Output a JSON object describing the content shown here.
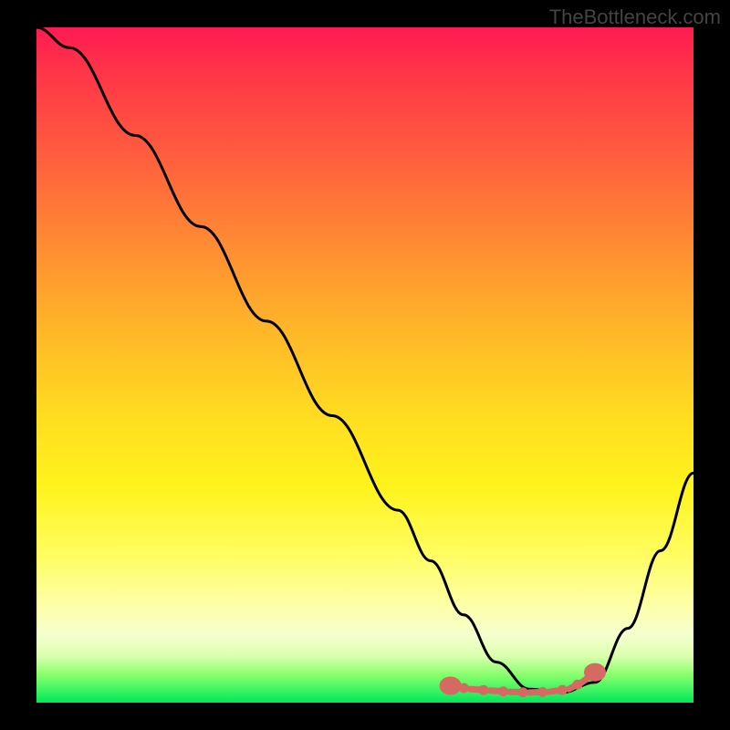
{
  "watermark": "TheBottleneck.com",
  "chart_data": {
    "type": "line",
    "title": "",
    "xlabel": "",
    "ylabel": "",
    "xlim": [
      0,
      100
    ],
    "ylim": [
      0,
      100
    ],
    "note": "Axes carry no tick labels in the source image; values below are plot-relative percentages read from pixel positions. The black curve is a V-shaped score curve; red markers indicate the flat minimum region.",
    "series": [
      {
        "name": "score-curve",
        "color": "#000000",
        "x": [
          0,
          5,
          15,
          25,
          35,
          45,
          55,
          60,
          65,
          70,
          75,
          80,
          85,
          90,
          95,
          100
        ],
        "y": [
          100,
          97,
          84,
          70.5,
          56.5,
          42.5,
          28.5,
          21,
          13,
          6,
          2,
          1.5,
          3,
          11,
          22.5,
          34
        ]
      }
    ],
    "markers": [
      {
        "name": "optimal-range",
        "color": "#d66a63",
        "style": "dash-dot",
        "points_x": [
          63,
          66,
          69,
          72,
          75,
          78,
          81,
          83,
          85
        ],
        "points_y": [
          2.5,
          2,
          1.8,
          1.6,
          1.5,
          1.6,
          2,
          3,
          4.5
        ]
      }
    ],
    "background": {
      "type": "vertical-gradient",
      "stops": [
        {
          "pos": 0,
          "color": "#ff1a52"
        },
        {
          "pos": 18,
          "color": "#ff5a3f"
        },
        {
          "pos": 46,
          "color": "#ffba28"
        },
        {
          "pos": 68,
          "color": "#fff31c"
        },
        {
          "pos": 90,
          "color": "#f6ffce"
        },
        {
          "pos": 100,
          "color": "#00e85a"
        }
      ]
    }
  }
}
